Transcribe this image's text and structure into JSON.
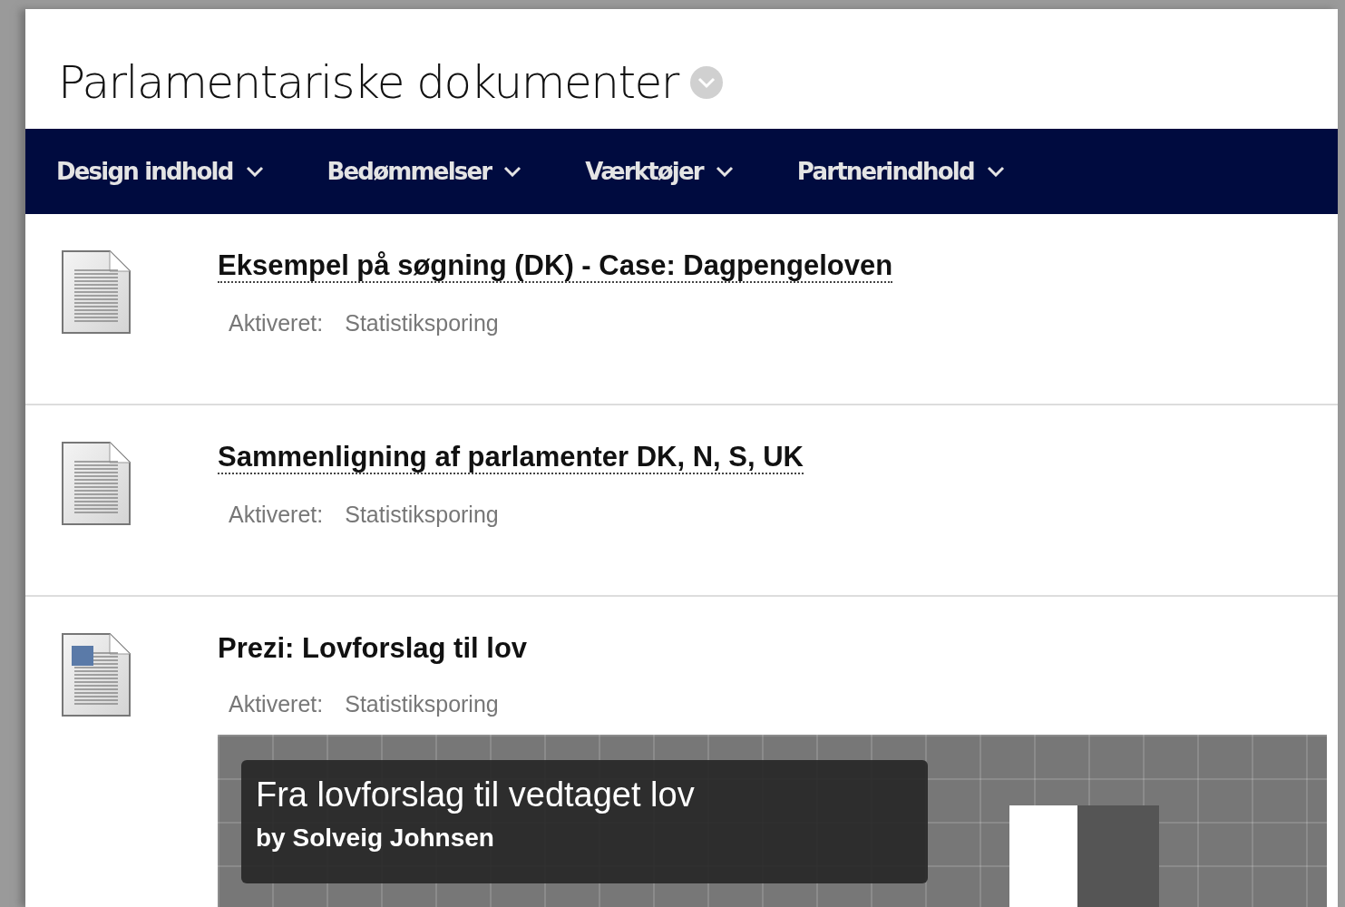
{
  "page": {
    "title": "Parlamentariske dokumenter"
  },
  "nav": [
    {
      "label": "Design indhold"
    },
    {
      "label": "Bedømmelser"
    },
    {
      "label": "Værktøjer"
    },
    {
      "label": "Partnerindhold"
    }
  ],
  "items": [
    {
      "kind": "document",
      "title": "Eksempel på søgning (DK) - Case: Dagpengeloven",
      "link": true,
      "meta_label": "Aktiveret:",
      "meta_value": "Statistiksporing"
    },
    {
      "kind": "document",
      "title": "Sammenligning af parlamenter DK, N, S, UK",
      "link": true,
      "meta_label": "Aktiveret:",
      "meta_value": "Statistiksporing"
    },
    {
      "kind": "image-document",
      "title": "Prezi: Lovforslag til lov",
      "link": false,
      "meta_label": "Aktiveret:",
      "meta_value": "Statistiksporing",
      "embed": {
        "title": "Fra lovforslag til vedtaget lov",
        "byline": "by Solveig Johnsen"
      }
    }
  ]
}
